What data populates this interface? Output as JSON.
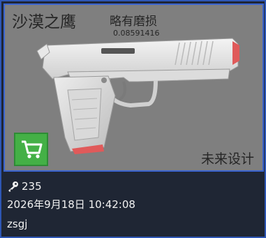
{
  "item": {
    "name": "沙漠之鹰",
    "wear_label": "略有磨损",
    "wear_value": "0.08591416",
    "category": "未来设计"
  },
  "cart": {
    "icon": "shopping-cart-icon"
  },
  "info": {
    "key_icon": "key-icon",
    "count": "235",
    "datetime": "2026年9月18日 10:42:08",
    "user": "zsgj"
  },
  "colors": {
    "panel_bg": "#7f7f7f",
    "card_bg": "#1f2634",
    "border_blue": "#2e56b4",
    "cart_green": "#44b046",
    "accent_red": "#e05a5a"
  }
}
